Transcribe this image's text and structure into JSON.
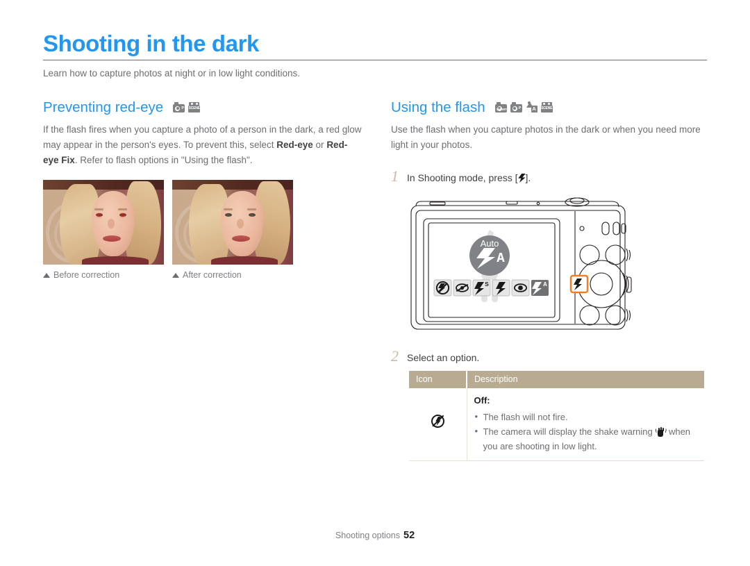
{
  "page": {
    "title": "Shooting in the dark",
    "intro": "Learn how to capture photos at night or in low light conditions.",
    "accent_color": "#2196f3",
    "footer_label": "Shooting options",
    "footer_page": "52"
  },
  "left_section": {
    "heading": "Preventing red-eye",
    "mode_icons": [
      {
        "name": "program-mode-icon",
        "tag": "P"
      },
      {
        "name": "scene-mode-icon",
        "tag": "SCENE"
      }
    ],
    "body_parts": [
      {
        "text": "If the flash fires when you capture a photo of a person in the dark, a red glow may appear in the person's eyes. To prevent this, select ",
        "bold": false
      },
      {
        "text": "Red-eye",
        "bold": true
      },
      {
        "text": " or ",
        "bold": false
      },
      {
        "text": "Red-eye Fix",
        "bold": true
      },
      {
        "text": ". Refer to flash options in \"Using the flash\".",
        "bold": false
      }
    ],
    "photos": [
      {
        "caption": "Before correction",
        "state": "red-eye-visible"
      },
      {
        "caption": "After correction",
        "state": "red-eye-corrected"
      }
    ]
  },
  "right_section": {
    "heading": "Using the flash",
    "mode_icons": [
      {
        "name": "smart-auto-mode-icon",
        "tag": "SMART"
      },
      {
        "name": "program-mode-icon",
        "tag": "P"
      },
      {
        "name": "scene-auto-mode-icon",
        "tag": "A"
      },
      {
        "name": "scene-mode-icon",
        "tag": "SCENE"
      }
    ],
    "body": "Use the flash when you capture photos in the dark or when you need more light in your photos.",
    "steps": [
      {
        "num": "1",
        "text_before": "In Shooting mode, press [",
        "text_after": "]."
      },
      {
        "num": "2",
        "text_before": "Select an option.",
        "text_after": ""
      }
    ],
    "camera": {
      "screen_flash_label": "Auto",
      "screen_flash_mode": "A",
      "option_strip": [
        "flash-off",
        "red-eye",
        "slow-sync",
        "fill-in",
        "red-eye-fix",
        "auto-flash"
      ],
      "selected_option_index": 5,
      "highlight_color": "#f07d23",
      "highlighted_button": "flash-button"
    },
    "table": {
      "headers": [
        "Icon",
        "Description"
      ],
      "header_bg": "#b8ab92",
      "rows": [
        {
          "icon": "flash-off-icon",
          "title": "Off",
          "bullets": [
            "The flash will not fire.",
            "The camera will display the shake warning   when you are shooting in low light."
          ],
          "bullet1": "The flash will not fire.",
          "bullet2_pre": "The camera will display the shake warning ",
          "bullet2_post": " when you are shooting in low light."
        }
      ]
    }
  }
}
